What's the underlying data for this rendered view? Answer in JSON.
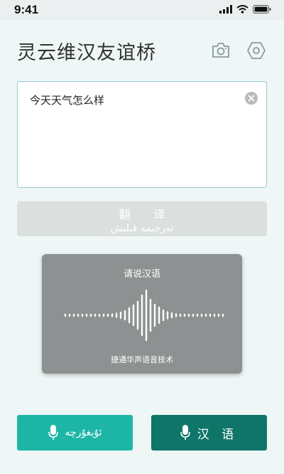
{
  "status_bar": {
    "time": "9:41"
  },
  "header": {
    "title": "灵云维汉友谊桥",
    "camera_icon": "camera-icon",
    "settings_icon": "hexagon-settings-icon"
  },
  "input": {
    "value": "今天天气怎么样",
    "clear_icon": "clear-icon"
  },
  "translate_button": {
    "label_cn": "翻 译",
    "label_ug": "تەرجىمە قىلىش"
  },
  "voice_panel": {
    "prompt": "请说汉语",
    "credit": "捷通华声语音技术"
  },
  "language_buttons": {
    "uyghur_label": "ئۇيغۇرچە",
    "chinese_label": "汉 语"
  },
  "colors": {
    "background": "#eef6f6",
    "accent_light": "#1db6a6",
    "accent_dark": "#0f7569",
    "panel": "#8e9191",
    "translate_disabled": "#dbe0df"
  }
}
